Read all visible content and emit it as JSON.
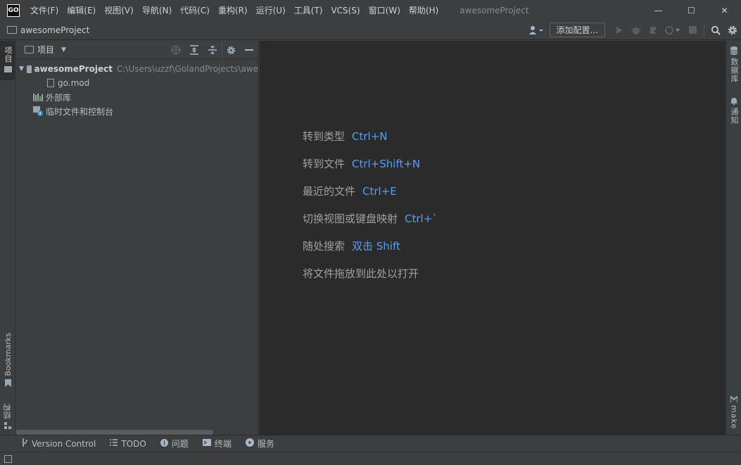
{
  "app": {
    "logo_text": "GO",
    "window_title": "awesomeProject"
  },
  "menu": [
    {
      "label": "文件(F)"
    },
    {
      "label": "编辑(E)"
    },
    {
      "label": "视图(V)"
    },
    {
      "label": "导航(N)"
    },
    {
      "label": "代码(C)"
    },
    {
      "label": "重构(R)"
    },
    {
      "label": "运行(U)"
    },
    {
      "label": "工具(T)"
    },
    {
      "label": "VCS(S)"
    },
    {
      "label": "窗口(W)"
    },
    {
      "label": "帮助(H)"
    }
  ],
  "window_controls": {
    "minimize": "—",
    "maximize": "☐",
    "close": "✕"
  },
  "navbar": {
    "project_name": "awesomeProject",
    "add_config_label": "添加配置..."
  },
  "left_stripe": {
    "project_tab": "项目",
    "bookmarks_tab": "Bookmarks",
    "structure_tab": "结构"
  },
  "project_panel": {
    "title": "项目",
    "tree": {
      "root_name": "awesomeProject",
      "root_path": "C:\\Users\\uzzf\\GolandProjects\\awe",
      "file_name": "go.mod",
      "external_libs": "外部库",
      "scratches": "临时文件和控制台"
    }
  },
  "editor_hints": [
    {
      "action": "转到类型",
      "shortcut": "Ctrl+N"
    },
    {
      "action": "转到文件",
      "shortcut": "Ctrl+Shift+N"
    },
    {
      "action": "最近的文件",
      "shortcut": "Ctrl+E"
    },
    {
      "action": "切换视图或键盘映射",
      "shortcut": "Ctrl+`"
    },
    {
      "action": "随处搜索",
      "shortcut": "双击 Shift"
    },
    {
      "action": "将文件拖放到此处以打开",
      "shortcut": ""
    }
  ],
  "right_stripe": {
    "database_tab": "数据库",
    "notifications_tab": "通知",
    "make_tab": "make"
  },
  "bottom_bar": [
    {
      "label": "Version Control",
      "icon": "branch-icon"
    },
    {
      "label": "TODO",
      "icon": "list-icon"
    },
    {
      "label": "问题",
      "icon": "info-icon"
    },
    {
      "label": "终端",
      "icon": "terminal-icon"
    },
    {
      "label": "服务",
      "icon": "play-circle-icon"
    }
  ],
  "colors": {
    "background": "#3c3f41",
    "editor_background": "#2b2b2b",
    "shortcut_accent": "#589df6",
    "hint_text": "#a0a0a0"
  }
}
